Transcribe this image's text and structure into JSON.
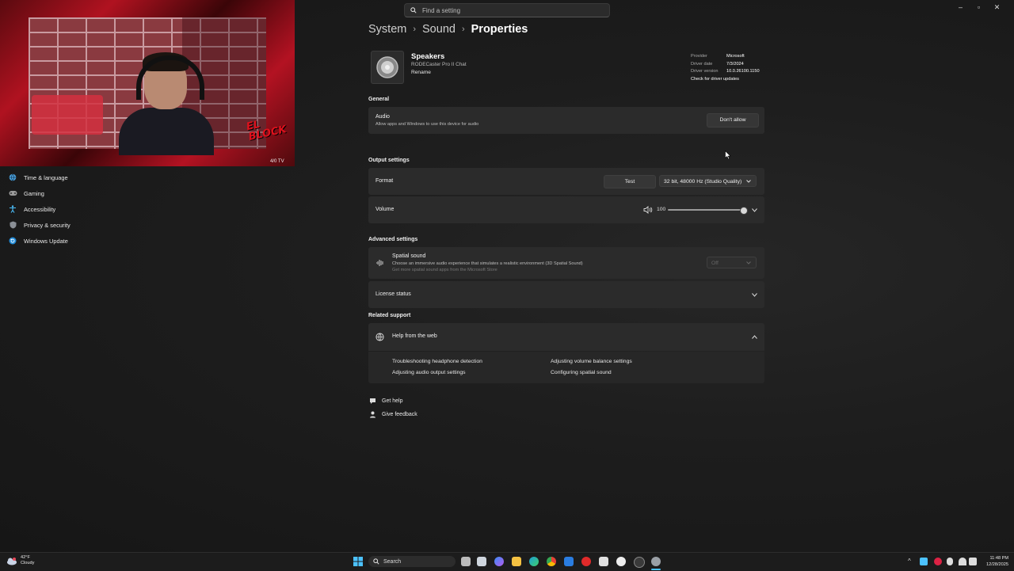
{
  "window": {
    "minimize": "–",
    "restore": "▫",
    "close": "✕"
  },
  "search": {
    "placeholder": "Find a setting"
  },
  "webcam": {
    "logo_text": "EL BLOCK",
    "badge": "4/0 TV"
  },
  "sidebar": {
    "items": [
      {
        "label": "Time & language",
        "icon": "globe-clock-icon"
      },
      {
        "label": "Gaming",
        "icon": "gamepad-icon"
      },
      {
        "label": "Accessibility",
        "icon": "accessibility-icon"
      },
      {
        "label": "Privacy & security",
        "icon": "shield-icon"
      },
      {
        "label": "Windows Update",
        "icon": "update-icon"
      }
    ]
  },
  "breadcrumb": {
    "items": [
      "System",
      "Sound"
    ],
    "current": "Properties"
  },
  "device": {
    "name": "Speakers",
    "subtitle": "RODECaster Pro II Chat",
    "rename": "Rename",
    "driver": {
      "provider_label": "Provider",
      "provider": "Microsoft",
      "date_label": "Driver date",
      "date": "7/3/2024",
      "version_label": "Driver version",
      "version": "10.0.26100.1150",
      "check_link": "Check for driver updates"
    }
  },
  "general": {
    "heading": "General",
    "audio_label": "Audio",
    "audio_desc": "Allow apps and Windows to use this device for audio",
    "dont_allow": "Don't allow"
  },
  "output": {
    "heading": "Output settings",
    "format_label": "Format",
    "test_button": "Test",
    "format_value": "32 bit, 48000 Hz (Studio Quality)",
    "volume_label": "Volume",
    "volume_value": "100",
    "volume_level": 1.0
  },
  "advanced": {
    "heading": "Advanced settings",
    "spatial_label": "Spatial sound",
    "spatial_desc": "Choose an immersive audio experience that simulates a realistic environment (3D Spatial Sound)",
    "spatial_link": "Get more spatial sound apps from the Microsoft Store",
    "spatial_value": "Off",
    "license_label": "License status"
  },
  "related": {
    "heading": "Related support",
    "help_label": "Help from the web",
    "links": [
      "Troubleshooting headphone detection",
      "Adjusting volume balance settings",
      "Adjusting audio output settings",
      "Configuring spatial sound"
    ]
  },
  "footer": {
    "get_help": "Get help",
    "give_feedback": "Give feedback"
  },
  "taskbar": {
    "weather_temp": "42°F",
    "weather_desc": "Cloudy",
    "search_label": "Search",
    "time": "11:48 PM",
    "date": "12/28/2025"
  },
  "colors": {
    "accent": "#4cc2ff",
    "cam_red": "#b01220"
  }
}
